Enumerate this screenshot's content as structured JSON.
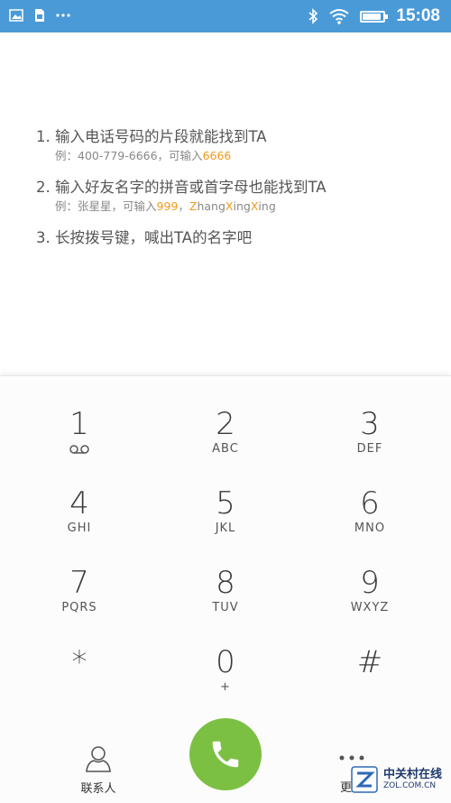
{
  "status_bar": {
    "left_icons": [
      "image-icon",
      "sim-card-icon",
      "more-dots-icon"
    ],
    "right_icons": [
      "bluetooth-icon",
      "wifi-icon",
      "battery-icon"
    ],
    "battery_level": 0.9,
    "time": "15:08"
  },
  "tips": [
    {
      "title": "1. 输入电话号码的片段就能找到TA",
      "sub_prefix": "例：400-779-6666，可输入",
      "sub_highlight": "6666"
    },
    {
      "title": "2. 输入好友名字的拼音或首字母也能找到TA",
      "sub_prefix": "例：张星星，可输入",
      "sub_highlight": "999",
      "sub_sep": "，",
      "pinyin": [
        {
          "t": "Z",
          "hl": true
        },
        {
          "t": "hang",
          "hl": false
        },
        {
          "t": "X",
          "hl": true
        },
        {
          "t": "ing",
          "hl": false
        },
        {
          "t": "X",
          "hl": true
        },
        {
          "t": "ing",
          "hl": false
        }
      ]
    },
    {
      "title": "3. 长按拨号键，喊出TA的名字吧"
    }
  ],
  "keys": [
    {
      "digit": "1",
      "letters": "",
      "icon": "voicemail-icon"
    },
    {
      "digit": "2",
      "letters": "ABC"
    },
    {
      "digit": "3",
      "letters": "DEF"
    },
    {
      "digit": "4",
      "letters": "GHI"
    },
    {
      "digit": "5",
      "letters": "JKL"
    },
    {
      "digit": "6",
      "letters": "MNO"
    },
    {
      "digit": "7",
      "letters": "PQRS"
    },
    {
      "digit": "8",
      "letters": "TUV"
    },
    {
      "digit": "9",
      "letters": "WXYZ"
    },
    {
      "digit": "*",
      "letters": ""
    },
    {
      "digit": "0",
      "letters": "+"
    },
    {
      "digit": "#",
      "letters": ""
    }
  ],
  "bottom": {
    "contacts_label": "联系人",
    "more_label": "更多",
    "call_icon": "phone-icon"
  },
  "watermark": {
    "text": "中关村在线",
    "sub": "ZOL.COM.CN"
  },
  "colors": {
    "status_bar": "#4a9ad8",
    "highlight": "#f19a1a",
    "call_button": "#7bc043"
  }
}
